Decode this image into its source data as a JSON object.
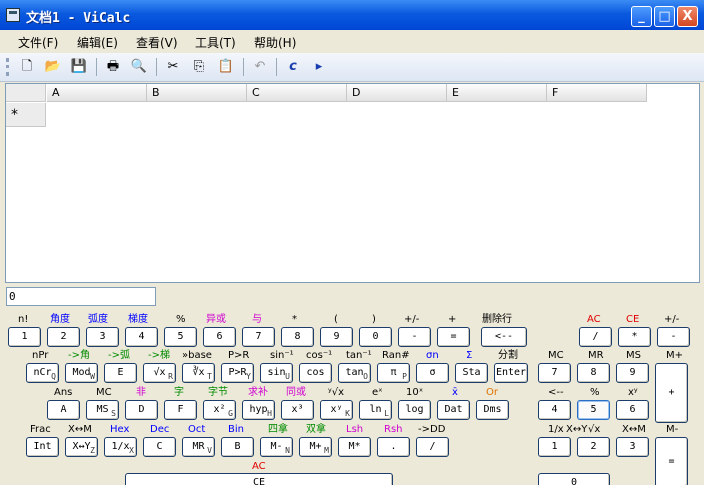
{
  "window": {
    "title": "文档1 - ViCalc",
    "buttons": [
      "_",
      "□",
      "X"
    ]
  },
  "menu": [
    "文件(F)",
    "编辑(E)",
    "查看(V)",
    "工具(T)",
    "帮助(H)"
  ],
  "toolbar": {
    "icons": [
      "new-icon",
      "open-icon",
      "save-icon",
      "print-icon",
      "print-preview-icon",
      "cut-icon",
      "copy-icon",
      "paste-icon",
      "undo-icon",
      "calc-icon",
      "run-icon"
    ]
  },
  "sheet": {
    "columns": [
      "A",
      "B",
      "C",
      "D",
      "E",
      "F"
    ],
    "row_marker": "*"
  },
  "calc": {
    "input_value": "0",
    "labels": {
      "r1": [
        "n!",
        "角度",
        "弧度",
        "梯度",
        "%",
        "异或",
        "与",
        "*",
        "(",
        ")",
        "+/-",
        "+",
        "删除行",
        "AC",
        "CE",
        "+/-"
      ],
      "r2": [
        "nPr",
        "->角",
        "->弧",
        "->梯",
        "»base",
        "P>R",
        "sin⁻¹",
        "cos⁻¹",
        "tan⁻¹",
        "Ran#",
        "σn",
        "Σ",
        "分割",
        "MC",
        "MR",
        "MS",
        "M+"
      ],
      "r3": [
        "Ans",
        "MC",
        "非",
        "字",
        "字节",
        "求补",
        "同或",
        "ʸ√x",
        "eˣ",
        "10ˣ",
        "x̄",
        "Or",
        "<--",
        "%",
        "xʸ"
      ],
      "r4": [
        "Frac",
        "X↔M",
        "Hex",
        "Dec",
        "Oct",
        "Bin",
        "四拿",
        "双拿",
        "Lsh",
        "Rsh",
        "->DD",
        "1/x",
        "√x",
        "X↔Y",
        "X↔M",
        "M-"
      ],
      "r5": [
        "AC"
      ]
    },
    "keys": {
      "r1": [
        "1",
        "2",
        "3",
        "4",
        "5",
        "6",
        "7",
        "8",
        "9",
        "0",
        "-",
        "=",
        "<--",
        "/",
        "*",
        "-"
      ],
      "r1sub": [
        "",
        "",
        "",
        "",
        "",
        "",
        "",
        "",
        "",
        "",
        "",
        "",
        "",
        "",
        "",
        ""
      ],
      "r2": [
        "nCr",
        "Mod",
        "E",
        "√x",
        "∛x",
        "P>R",
        "sin",
        "cos",
        "tan",
        "π",
        "σ",
        "Sta",
        "Enter",
        "7",
        "8",
        "9",
        "+"
      ],
      "r2sub": [
        "Q",
        "W",
        "",
        "R",
        "T",
        "Y",
        "U",
        "",
        "O",
        "P",
        "",
        "",
        "",
        "",
        "",
        ""
      ],
      "r3": [
        "A",
        "MS",
        "D",
        "F",
        "x²",
        "hyp",
        "x³",
        "xʸ",
        "ln",
        "log",
        "Dat",
        "Dms",
        "4",
        "5",
        "6"
      ],
      "r3sub": [
        "",
        "S",
        "",
        "",
        "G",
        "H",
        "",
        "K",
        "L",
        "",
        "",
        "",
        "",
        "",
        ""
      ],
      "r4": [
        "Int",
        "X↔Y",
        "1/x",
        "C",
        "MR",
        "B",
        "M-",
        "M+",
        "M*",
        ".",
        "/",
        "1",
        "2",
        "3",
        "="
      ],
      "r4sub": [
        "",
        "Z",
        "X",
        "",
        "V",
        "",
        "N",
        "M",
        "",
        "",
        "",
        "",
        "",
        "",
        ""
      ],
      "r5": [
        "CE",
        "0"
      ]
    }
  }
}
